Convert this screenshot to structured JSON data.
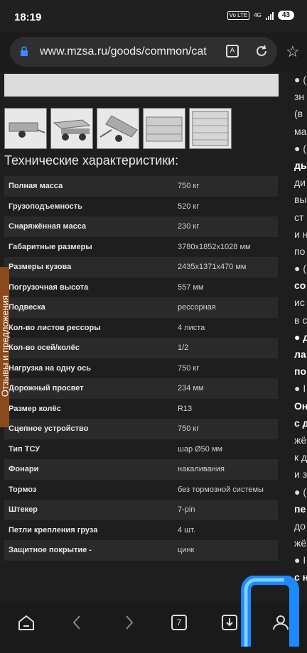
{
  "status": {
    "time": "18:19",
    "volte": "Vo LTE",
    "network": "4G",
    "battery": "43"
  },
  "browser": {
    "url": "www.mzsa.ru/goods/common/cat",
    "tab_count": "7"
  },
  "feedback_tab": "Отзывы и предложения",
  "specs": {
    "heading": "Технические характеристики:",
    "rows": [
      {
        "key": "Полная масса",
        "value": "750 кг"
      },
      {
        "key": "Грузоподъемность",
        "value": "520 кг"
      },
      {
        "key": "Снаряжённая масса",
        "value": "230 кг"
      },
      {
        "key": "Габаритные размеры",
        "value": "3780x1852x1028 мм"
      },
      {
        "key": "Размеры кузова",
        "value": "2435x1371x470 мм"
      },
      {
        "key": "Погрузочная высота",
        "value": "557 мм"
      },
      {
        "key": "Подвеска",
        "value": "рессорная"
      },
      {
        "key": "Кол-во листов рессоры",
        "value": "4 листа"
      },
      {
        "key": "Кол-во осей/колёс",
        "value": "1/2"
      },
      {
        "key": "Нагрузка на одну ось",
        "value": "750 кг"
      },
      {
        "key": "Дорожный просвет",
        "value": "234 мм"
      },
      {
        "key": "Размер колёс",
        "value": "R13"
      },
      {
        "key": "Сцепное устройство",
        "value": "750 кг"
      },
      {
        "key": "Тип ТСУ",
        "value": "шар Ø50 мм"
      },
      {
        "key": "Фонари",
        "value": "накаливания"
      },
      {
        "key": "Тормоз",
        "value": "без тормозной системы"
      },
      {
        "key": "Штекер",
        "value": "7-pin"
      },
      {
        "key": "Петли крепления груза",
        "value": "4 шт."
      },
      {
        "key": "Защитное покрытие -",
        "value": "цинк"
      }
    ]
  },
  "right_column": [
    {
      "t": "● (",
      "bold": false
    },
    {
      "t": "зн",
      "bold": false
    },
    {
      "t": "(в",
      "bold": false
    },
    {
      "t": "ма",
      "bold": false
    },
    {
      "t": "● (",
      "bold": false
    },
    {
      "t": "ды",
      "bold": true
    },
    {
      "t": "ди",
      "bold": false
    },
    {
      "t": "вы",
      "bold": false
    },
    {
      "t": "ст",
      "bold": false
    },
    {
      "t": "и н",
      "bold": false
    },
    {
      "t": "по",
      "bold": false
    },
    {
      "t": "● (",
      "bold": false
    },
    {
      "t": "со",
      "bold": true
    },
    {
      "t": "ис",
      "bold": false
    },
    {
      "t": "в с",
      "bold": false
    },
    {
      "t": "● д",
      "bold": true
    },
    {
      "t": "ла",
      "bold": true
    },
    {
      "t": "по",
      "bold": true
    },
    {
      "t": "● I",
      "bold": false
    },
    {
      "t": "Он",
      "bold": true
    },
    {
      "t": "с д",
      "bold": true
    },
    {
      "t": "жё",
      "bold": false
    },
    {
      "t": "к д",
      "bold": false
    },
    {
      "t": "и з",
      "bold": false
    },
    {
      "t": "● (",
      "bold": false
    },
    {
      "t": "пе",
      "bold": true
    },
    {
      "t": "до",
      "bold": false
    },
    {
      "t": "жё",
      "bold": false
    },
    {
      "t": "● I",
      "bold": false
    },
    {
      "t": "с н",
      "bold": true
    }
  ]
}
